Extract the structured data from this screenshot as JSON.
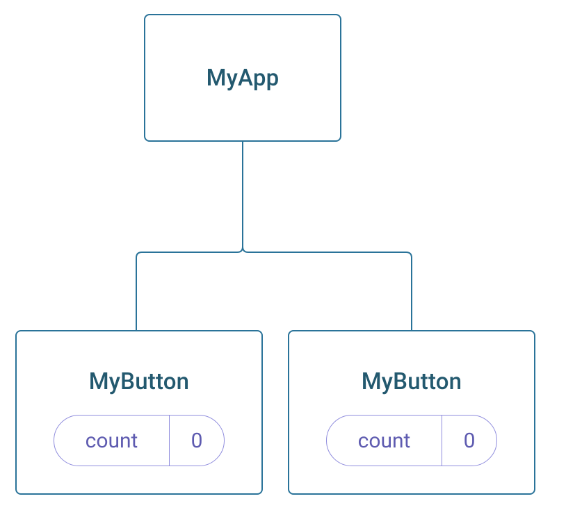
{
  "root": {
    "title": "MyApp"
  },
  "children": [
    {
      "title": "MyButton",
      "state_label": "count",
      "state_value": "0"
    },
    {
      "title": "MyButton",
      "state_label": "count",
      "state_value": "0"
    }
  ],
  "colors": {
    "box_border": "#2a7399",
    "text_primary": "#23596f",
    "pill_border": "#8f8cdd",
    "pill_text": "#5e5bb0"
  }
}
